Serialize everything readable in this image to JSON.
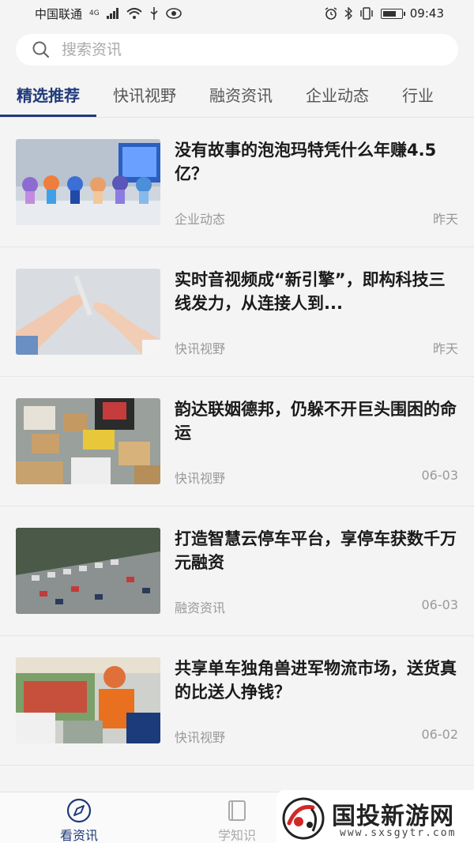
{
  "status_bar": {
    "carrier": "中国联通",
    "network": "4G",
    "time": "09:43",
    "battery_level": 0.75
  },
  "search": {
    "placeholder": "搜索资讯"
  },
  "tabs": [
    {
      "label": "精选推荐",
      "active": true
    },
    {
      "label": "快讯视野",
      "active": false
    },
    {
      "label": "融资资讯",
      "active": false
    },
    {
      "label": "企业动态",
      "active": false
    },
    {
      "label": "行业",
      "active": false
    }
  ],
  "news": [
    {
      "title": "没有故事的泡泡玛特凭什么年赚4.5亿？",
      "category": "企业动态",
      "time": "昨天"
    },
    {
      "title": "实时音视频成“新引擎”，即构科技三线发力，从连接人到...",
      "category": "快讯视野",
      "time": "昨天"
    },
    {
      "title": "韵达联姻德邦，仍躲不开巨头围困的命运",
      "category": "快讯视野",
      "time": "06-03"
    },
    {
      "title": "打造智慧云停车平台，享停车获数千万元融资",
      "category": "融资资讯",
      "time": "06-03"
    },
    {
      "title": "共享单车独角兽进军物流市场，送货真的比送人挣钱？",
      "category": "快讯视野",
      "time": "06-02"
    }
  ],
  "bottom_nav": [
    {
      "label": "看资讯",
      "icon": "compass-icon",
      "active": true
    },
    {
      "label": "学知识",
      "icon": "book-icon",
      "active": false
    }
  ],
  "watermark": {
    "title": "国投新游网",
    "url": "www.sxsgytr.com"
  },
  "colors": {
    "accent": "#1f3a7a",
    "background": "#f4f4f4",
    "muted_text": "#999999"
  }
}
